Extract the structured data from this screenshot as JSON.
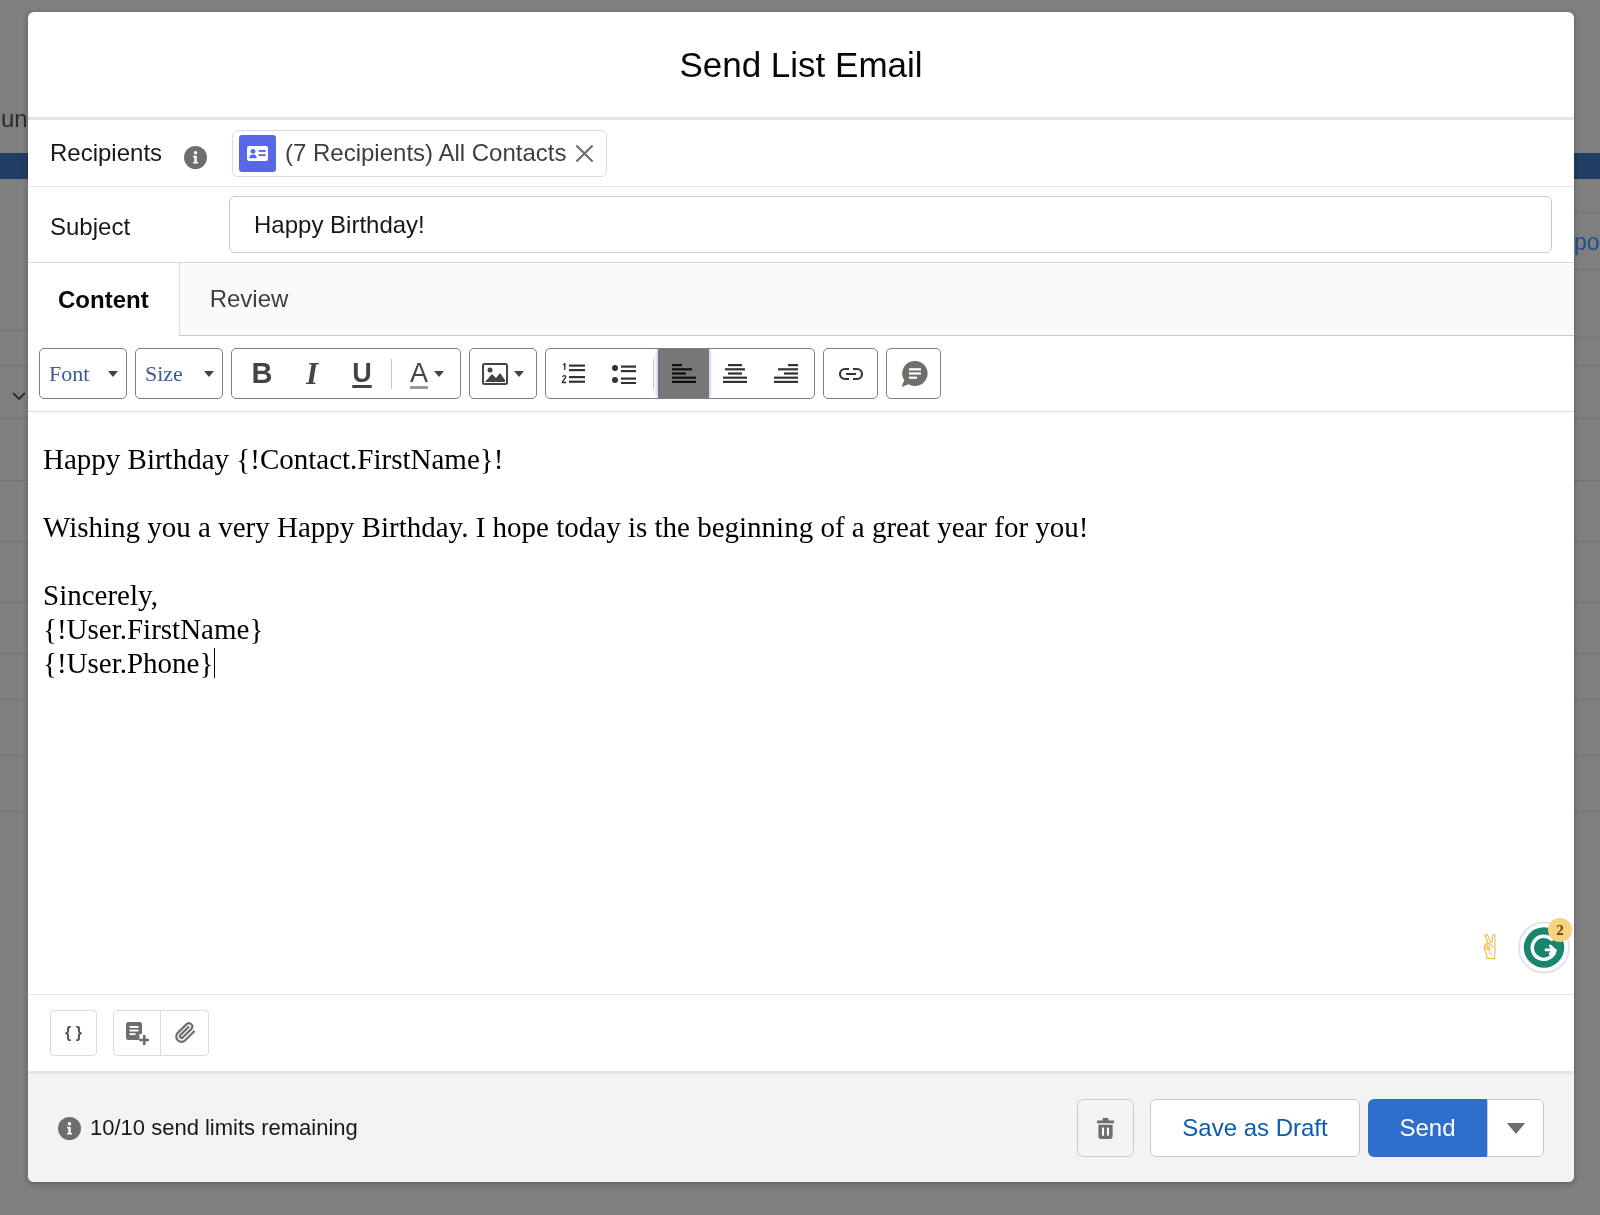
{
  "background_page": {
    "left_fragment": "un",
    "right_fragment": "po"
  },
  "dialog": {
    "title": "Send List Email"
  },
  "recipients": {
    "label": "Recipients",
    "chips": [
      {
        "text": "(7 Recipients) All Contacts"
      }
    ]
  },
  "subject": {
    "label": "Subject",
    "value": "Happy Birthday!"
  },
  "tabs": [
    {
      "label": "Content",
      "selected": true
    },
    {
      "label": "Review",
      "selected": false
    }
  ],
  "toolbar": {
    "font_dropdown": "Font",
    "size_dropdown": "Size",
    "format_buttons": [
      {
        "kind": "bold",
        "label": "B"
      },
      {
        "kind": "italic",
        "label": "I"
      },
      {
        "kind": "underline",
        "label": "U"
      }
    ],
    "text_color_button": "A",
    "alignment_buttons": [
      {
        "kind": "left",
        "selected": true
      },
      {
        "kind": "center",
        "selected": false
      },
      {
        "kind": "right",
        "selected": false
      }
    ]
  },
  "body": {
    "focused": true,
    "paragraphs": [
      {
        "lines": [
          "Happy Birthday {!Contact.FirstName}!"
        ]
      },
      {
        "lines": [
          "Wishing you a very Happy Birthday. I hope today is the beginning of a great year for you!"
        ]
      },
      {
        "lines": [
          "Sincerely,",
          "{!User.FirstName}",
          "{!User.Phone}"
        ]
      }
    ]
  },
  "overlay_widgets": {
    "emoji": "✌",
    "assistant_badge": "2"
  },
  "bottom_toolbar": {
    "merge_field_button": "{ }"
  },
  "footer": {
    "send_limits": "10/10 send limits remaining",
    "save_draft_button": "Save as Draft",
    "send_button": "Send"
  }
}
